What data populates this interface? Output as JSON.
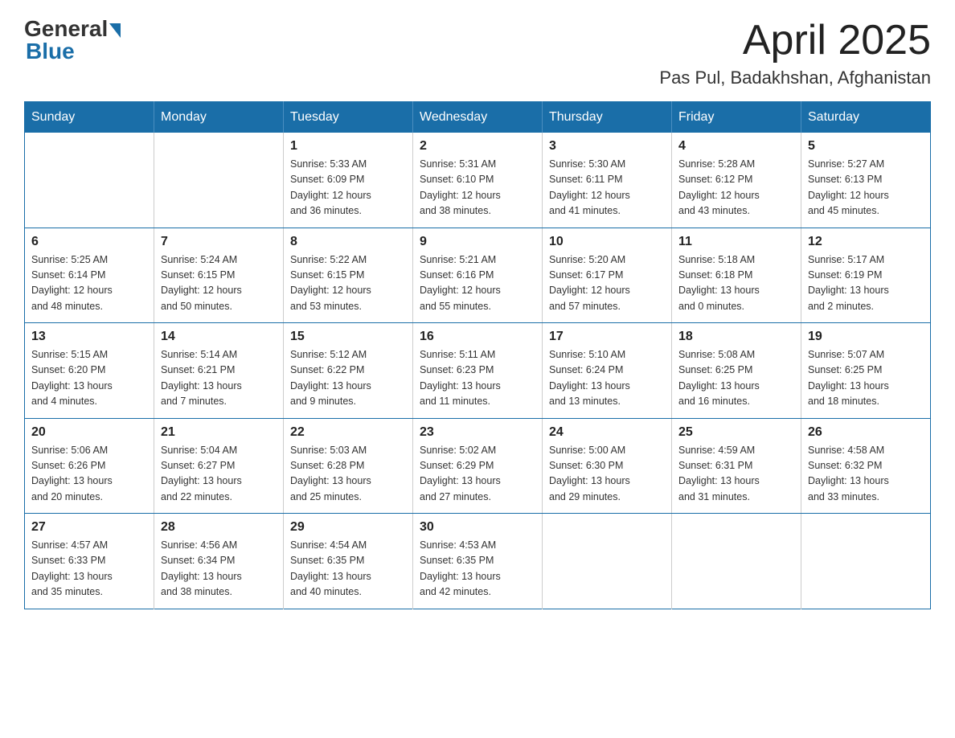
{
  "logo": {
    "general": "General",
    "blue": "Blue"
  },
  "title": "April 2025",
  "location": "Pas Pul, Badakhshan, Afghanistan",
  "headers": [
    "Sunday",
    "Monday",
    "Tuesday",
    "Wednesday",
    "Thursday",
    "Friday",
    "Saturday"
  ],
  "weeks": [
    [
      {
        "day": "",
        "info": ""
      },
      {
        "day": "",
        "info": ""
      },
      {
        "day": "1",
        "info": "Sunrise: 5:33 AM\nSunset: 6:09 PM\nDaylight: 12 hours\nand 36 minutes."
      },
      {
        "day": "2",
        "info": "Sunrise: 5:31 AM\nSunset: 6:10 PM\nDaylight: 12 hours\nand 38 minutes."
      },
      {
        "day": "3",
        "info": "Sunrise: 5:30 AM\nSunset: 6:11 PM\nDaylight: 12 hours\nand 41 minutes."
      },
      {
        "day": "4",
        "info": "Sunrise: 5:28 AM\nSunset: 6:12 PM\nDaylight: 12 hours\nand 43 minutes."
      },
      {
        "day": "5",
        "info": "Sunrise: 5:27 AM\nSunset: 6:13 PM\nDaylight: 12 hours\nand 45 minutes."
      }
    ],
    [
      {
        "day": "6",
        "info": "Sunrise: 5:25 AM\nSunset: 6:14 PM\nDaylight: 12 hours\nand 48 minutes."
      },
      {
        "day": "7",
        "info": "Sunrise: 5:24 AM\nSunset: 6:15 PM\nDaylight: 12 hours\nand 50 minutes."
      },
      {
        "day": "8",
        "info": "Sunrise: 5:22 AM\nSunset: 6:15 PM\nDaylight: 12 hours\nand 53 minutes."
      },
      {
        "day": "9",
        "info": "Sunrise: 5:21 AM\nSunset: 6:16 PM\nDaylight: 12 hours\nand 55 minutes."
      },
      {
        "day": "10",
        "info": "Sunrise: 5:20 AM\nSunset: 6:17 PM\nDaylight: 12 hours\nand 57 minutes."
      },
      {
        "day": "11",
        "info": "Sunrise: 5:18 AM\nSunset: 6:18 PM\nDaylight: 13 hours\nand 0 minutes."
      },
      {
        "day": "12",
        "info": "Sunrise: 5:17 AM\nSunset: 6:19 PM\nDaylight: 13 hours\nand 2 minutes."
      }
    ],
    [
      {
        "day": "13",
        "info": "Sunrise: 5:15 AM\nSunset: 6:20 PM\nDaylight: 13 hours\nand 4 minutes."
      },
      {
        "day": "14",
        "info": "Sunrise: 5:14 AM\nSunset: 6:21 PM\nDaylight: 13 hours\nand 7 minutes."
      },
      {
        "day": "15",
        "info": "Sunrise: 5:12 AM\nSunset: 6:22 PM\nDaylight: 13 hours\nand 9 minutes."
      },
      {
        "day": "16",
        "info": "Sunrise: 5:11 AM\nSunset: 6:23 PM\nDaylight: 13 hours\nand 11 minutes."
      },
      {
        "day": "17",
        "info": "Sunrise: 5:10 AM\nSunset: 6:24 PM\nDaylight: 13 hours\nand 13 minutes."
      },
      {
        "day": "18",
        "info": "Sunrise: 5:08 AM\nSunset: 6:25 PM\nDaylight: 13 hours\nand 16 minutes."
      },
      {
        "day": "19",
        "info": "Sunrise: 5:07 AM\nSunset: 6:25 PM\nDaylight: 13 hours\nand 18 minutes."
      }
    ],
    [
      {
        "day": "20",
        "info": "Sunrise: 5:06 AM\nSunset: 6:26 PM\nDaylight: 13 hours\nand 20 minutes."
      },
      {
        "day": "21",
        "info": "Sunrise: 5:04 AM\nSunset: 6:27 PM\nDaylight: 13 hours\nand 22 minutes."
      },
      {
        "day": "22",
        "info": "Sunrise: 5:03 AM\nSunset: 6:28 PM\nDaylight: 13 hours\nand 25 minutes."
      },
      {
        "day": "23",
        "info": "Sunrise: 5:02 AM\nSunset: 6:29 PM\nDaylight: 13 hours\nand 27 minutes."
      },
      {
        "day": "24",
        "info": "Sunrise: 5:00 AM\nSunset: 6:30 PM\nDaylight: 13 hours\nand 29 minutes."
      },
      {
        "day": "25",
        "info": "Sunrise: 4:59 AM\nSunset: 6:31 PM\nDaylight: 13 hours\nand 31 minutes."
      },
      {
        "day": "26",
        "info": "Sunrise: 4:58 AM\nSunset: 6:32 PM\nDaylight: 13 hours\nand 33 minutes."
      }
    ],
    [
      {
        "day": "27",
        "info": "Sunrise: 4:57 AM\nSunset: 6:33 PM\nDaylight: 13 hours\nand 35 minutes."
      },
      {
        "day": "28",
        "info": "Sunrise: 4:56 AM\nSunset: 6:34 PM\nDaylight: 13 hours\nand 38 minutes."
      },
      {
        "day": "29",
        "info": "Sunrise: 4:54 AM\nSunset: 6:35 PM\nDaylight: 13 hours\nand 40 minutes."
      },
      {
        "day": "30",
        "info": "Sunrise: 4:53 AM\nSunset: 6:35 PM\nDaylight: 13 hours\nand 42 minutes."
      },
      {
        "day": "",
        "info": ""
      },
      {
        "day": "",
        "info": ""
      },
      {
        "day": "",
        "info": ""
      }
    ]
  ]
}
